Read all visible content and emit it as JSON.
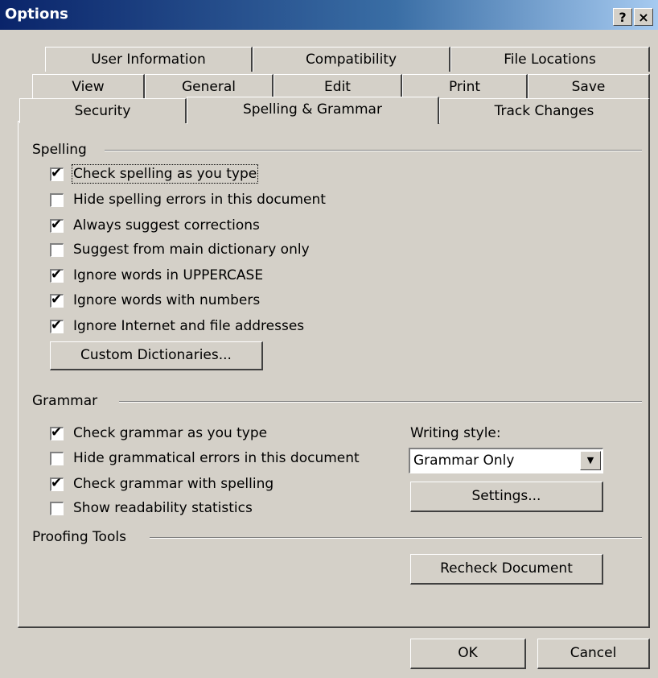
{
  "window": {
    "title": "Options",
    "help_label": "?",
    "close_label": "×"
  },
  "tabs": {
    "row1": [
      {
        "label": "User Information"
      },
      {
        "label": "Compatibility"
      },
      {
        "label": "File Locations"
      }
    ],
    "row2": [
      {
        "label": "View"
      },
      {
        "label": "General"
      },
      {
        "label": "Edit"
      },
      {
        "label": "Print"
      },
      {
        "label": "Save"
      }
    ],
    "row3": [
      {
        "label": "Security"
      },
      {
        "label": "Spelling & Grammar",
        "active": true
      },
      {
        "label": "Track Changes"
      }
    ]
  },
  "spelling": {
    "group_label": "Spelling",
    "options": [
      {
        "label": "Check spelling as you type",
        "checked": true
      },
      {
        "label": "Hide spelling errors in this document",
        "checked": false
      },
      {
        "label": "Always suggest corrections",
        "checked": true
      },
      {
        "label": "Suggest from main dictionary only",
        "checked": false
      },
      {
        "label": "Ignore words in UPPERCASE",
        "checked": true
      },
      {
        "label": "Ignore words with numbers",
        "checked": true
      },
      {
        "label": "Ignore Internet and file addresses",
        "checked": true
      }
    ],
    "custom_dictionaries_label": "Custom Dictionaries..."
  },
  "grammar": {
    "group_label": "Grammar",
    "options": [
      {
        "label": "Check grammar as you type",
        "checked": true
      },
      {
        "label": "Hide grammatical errors in this document",
        "checked": false
      },
      {
        "label": "Check grammar with spelling",
        "checked": true
      },
      {
        "label": "Show readability statistics",
        "checked": false
      }
    ],
    "writing_style_label": "Writing style:",
    "writing_style_value": "Grammar Only",
    "settings_label": "Settings..."
  },
  "proofing": {
    "group_label": "Proofing Tools",
    "recheck_label": "Recheck Document"
  },
  "footer": {
    "ok_label": "OK",
    "cancel_label": "Cancel"
  },
  "icons": {
    "check_mark": "✔",
    "dropdown_arrow": "▼"
  }
}
